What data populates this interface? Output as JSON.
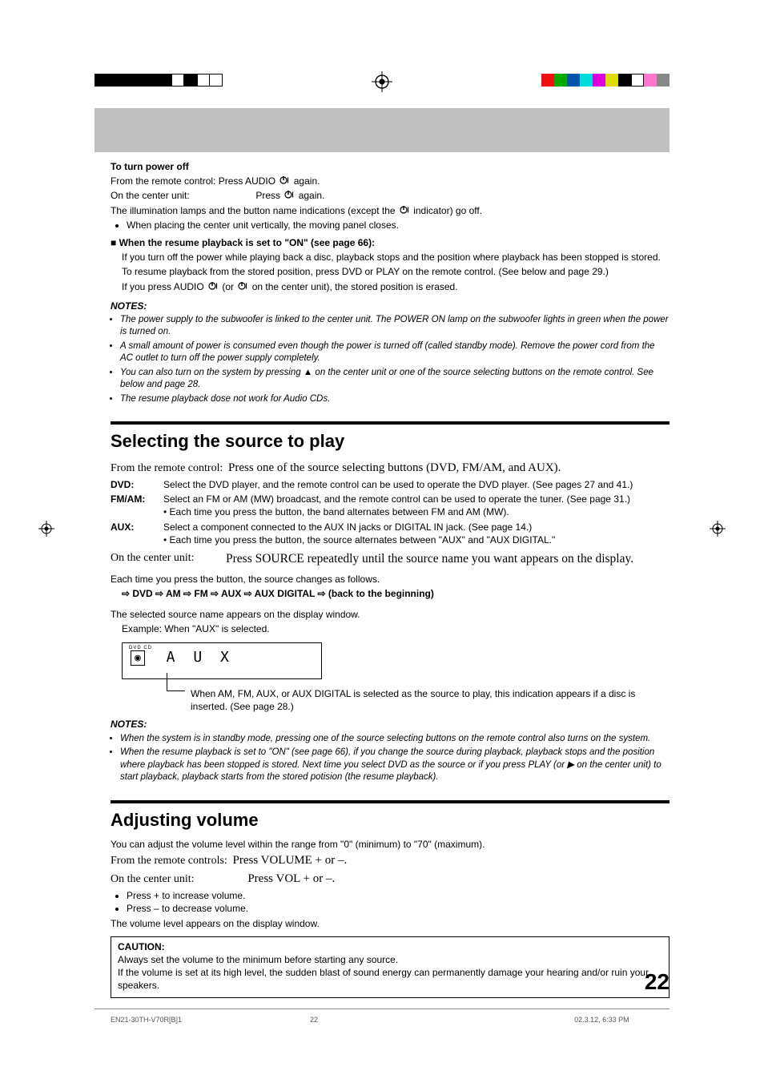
{
  "header": {},
  "to_turn_power_off": {
    "title": "To turn power off",
    "line1_prefix": "From the remote control:  Press AUDIO ",
    "line1_suffix": " again.",
    "line2_prefix": "On the center unit:",
    "line2_action": "Press ",
    "line2_suffix": " again.",
    "line3_prefix": "The illumination lamps and the button name indications (except the ",
    "line3_suffix": " indicator) go off.",
    "bullet1": "When placing the center unit vertically, the moving panel closes."
  },
  "resume_heading_prefix": "■ ",
  "resume_heading": "When the resume playback is set to \"ON\" (see page 66):",
  "resume_p1": "If you turn off the power while playing back a disc, playback stops and the position where playback has been stopped is stored.",
  "resume_p2": "To resume playback from the stored position, press DVD or PLAY on the remote control. (See below and page 29.)",
  "resume_p3_prefix": "If you press AUDIO ",
  "resume_p3_mid": " (or ",
  "resume_p3_suffix": " on the center unit), the stored position is erased.",
  "notes1_label": "NOTES:",
  "notes1": [
    "The power supply to the subwoofer is linked to the center unit. The POWER ON lamp on the subwoofer lights in green when the power is turned on.",
    "A small amount of power is consumed even though the power is turned off (called standby mode). Remove the power cord from the AC outlet to turn off the power supply completely.",
    "You can also turn on the system by pressing ▲ on the center unit or one of the source selecting buttons on the remote control. See below and page 28.",
    "The resume playback dose not work for Audio CDs."
  ],
  "selecting": {
    "title": "Selecting the source to play",
    "remote_label": "From the remote control:",
    "remote_action": "Press one of the source selecting buttons (DVD, FM/AM, and AUX).",
    "rows": {
      "dvd_k": "DVD:",
      "dvd_v": "Select the DVD player, and the remote control can be used to operate the DVD player. (See pages 27 and 41.)",
      "fm_k": "FM/AM:",
      "fm_v": "Select an FM or AM (MW) broadcast, and the remote control can be used to operate the tuner. (See page 31.)",
      "fm_b": "• Each time you press the button, the band alternates between FM and AM (MW).",
      "aux_k": "AUX:",
      "aux_v": "Select a component connected to the AUX IN jacks or DIGITAL IN jack. (See page 14.)",
      "aux_b": "• Each time you press the button, the source alternates between \"AUX\" and \"AUX DIGITAL.\""
    },
    "unit_label": "On the center unit:",
    "unit_action": "Press SOURCE repeatedly until the source name you want appears on the display.",
    "each_time": "Each time you press the button, the source changes as follows.",
    "cycle": "⇨ DVD ⇨ AM ⇨ FM ⇨ AUX ⇨ AUX DIGITAL ⇨ (back to the beginning)",
    "selected_line": "The selected source name appears on the display window.",
    "example_line": "Example: When \"AUX\" is selected.",
    "aux_dvdcd": "DVD CD",
    "aux_disc_glyph": "◉",
    "aux_text": "A U X",
    "aux_desc": "When AM, FM, AUX, or AUX DIGITAL is selected as the source to play, this indication appears if a disc is inserted. (See page 28.)"
  },
  "notes2_label": "NOTES:",
  "notes2": [
    "When the system is in standby mode, pressing one of the source selecting buttons on the remote control also turns on the system.",
    "When the resume playback is set to \"ON\" (see page 66), if you change the source during playback, playback stops and the position where playback has been stopped is stored. Next time you select DVD as the source or if you press PLAY (or ▶ on the center unit) to start playback, playback starts from the stored potision (the resume playback)."
  ],
  "volume": {
    "title": "Adjusting volume",
    "range": "You can adjust the volume level within the range from \"0\" (minimum) to \"70\" (maximum).",
    "remote_label": "From the remote controls:",
    "remote_action": "Press VOLUME + or –.",
    "unit_label": "On the center unit:",
    "unit_action": "Press VOL + or –.",
    "b1": "Press + to increase volume.",
    "b2": "Press – to decrease volume.",
    "appear": "The volume level appears on the display window."
  },
  "caution": {
    "label": "CAUTION:",
    "l1": "Always set the volume to the minimum before starting any source.",
    "l2": "If the volume is set at its high level, the sudden blast of sound energy can permanently damage your hearing and/or ruin your speakers."
  },
  "page_number": "22",
  "footer": {
    "file": "EN21-30TH-V70R[B]1",
    "pg": "22",
    "ts": "02.3.12, 6:33 PM"
  }
}
